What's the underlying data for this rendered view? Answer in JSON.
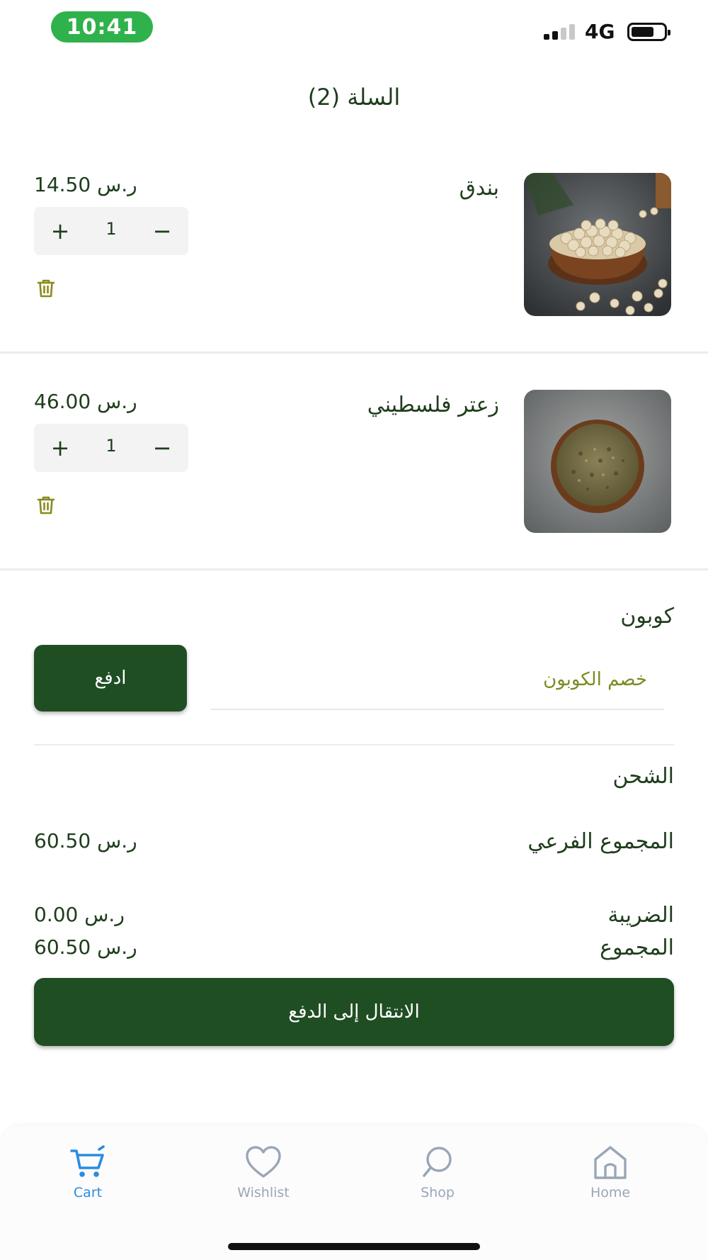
{
  "status_bar": {
    "time": "10:41",
    "network": "4G",
    "battery_level": 0.7
  },
  "header": {
    "title": "السلة (2)"
  },
  "cart": {
    "items": [
      {
        "name": "بندق",
        "price": "ر.س 14.50",
        "quantity": "1",
        "increment": "+",
        "decrement": "−",
        "image": "hazelnut-bowl"
      },
      {
        "name": "زعتر فلسطيني",
        "price": "ر.س 46.00",
        "quantity": "1",
        "increment": "+",
        "decrement": "−",
        "image": "zaatar-bowl"
      }
    ]
  },
  "coupon": {
    "label": "كوبون",
    "placeholder": "خصم الكوبون",
    "apply_label": "ادفع"
  },
  "summary": {
    "shipping_label": "الشحن",
    "subtotal_label": "المجموع الفرعي",
    "subtotal_value": "ر.س 60.50",
    "tax_label": "الضريبة",
    "tax_value": "ر.س 0.00",
    "total_label": "المجموع",
    "total_value": "ر.س 60.50"
  },
  "checkout": {
    "label": "الانتقال إلى الدفع"
  },
  "bottom_nav": {
    "items": [
      {
        "label": "Cart",
        "icon": "cart-icon",
        "active": true
      },
      {
        "label": "Wishlist",
        "icon": "heart-icon",
        "active": false
      },
      {
        "label": "Shop",
        "icon": "search-icon",
        "active": false
      },
      {
        "label": "Home",
        "icon": "home-icon",
        "active": false
      }
    ]
  },
  "colors": {
    "primary": "#1f4e23",
    "text": "#1f3d1c",
    "status_pill": "#2fb24c",
    "nav_active": "#2a8be0",
    "nav_inactive": "#9aa6b6",
    "trash_icon": "#8a8a1e"
  }
}
